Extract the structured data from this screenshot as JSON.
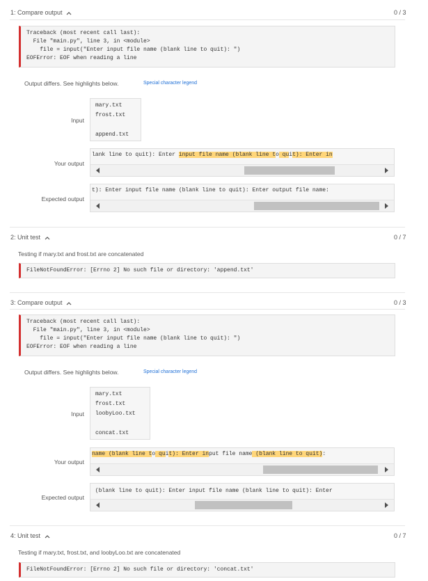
{
  "sections": [
    {
      "header": "1: Compare output",
      "score": "0 / 3",
      "error": [
        "Traceback (most recent call last):",
        "  File \"main.py\", line 3, in <module>",
        "    file = input(\"Enter input file name (blank line to quit): \")",
        "EOFError: EOF when reading a line"
      ],
      "note": "Output differs. See highlights below.",
      "legend": "Special character legend",
      "input_label": "Input",
      "input_lines": [
        "mary.txt",
        "frost.txt",
        "",
        "append.txt"
      ],
      "your_label": "Your output",
      "your_segments": [
        {
          "t": "lank line to quit): Enter ",
          "h": false
        },
        {
          "t": "input file name (blank line t",
          "h": true
        },
        {
          "t": "o",
          "h": false
        },
        {
          "t": " qu",
          "h": true
        },
        {
          "t": "i",
          "h": false
        },
        {
          "t": "t): Enter in",
          "h": true
        }
      ],
      "expected_label": "Expected output",
      "expected_text": "t): Enter input file name (blank line to quit): Enter output file name:"
    },
    {
      "header": "2: Unit test",
      "score": "0 / 7",
      "text": "Testing if mary.txt and frost.txt are concatenated",
      "error": "FileNotFoundError: [Errno 2] No such file or directory: 'append.txt'"
    },
    {
      "header": "3: Compare output",
      "score": "0 / 3",
      "error": [
        "Traceback (most recent call last):",
        "  File \"main.py\", line 3, in <module>",
        "    file = input(\"Enter input file name (blank line to quit): \")",
        "EOFError: EOF when reading a line"
      ],
      "note": "Output differs. See highlights below.",
      "legend": "Special character legend",
      "input_label": "Input",
      "input_lines": [
        "mary.txt",
        "frost.txt",
        "loobyLoo.txt",
        "",
        "concat.txt"
      ],
      "your_label": "Your output",
      "your_segments": [
        {
          "t": "name (blank line t",
          "h": true
        },
        {
          "t": "o",
          "h": false
        },
        {
          "t": " qu",
          "h": true
        },
        {
          "t": "i",
          "h": false
        },
        {
          "t": "t): Enter in",
          "h": true
        },
        {
          "t": "put file name",
          "h": false
        },
        {
          "t": " (blank line to quit)",
          "h": true
        },
        {
          "t": ":",
          "h": false
        }
      ],
      "expected_label": "Expected output",
      "expected_text": " (blank line to quit): Enter input file name (blank line to quit): Enter"
    },
    {
      "header": "4: Unit test",
      "score": "0 / 7",
      "text": "Testing if mary.txt, frost.txt, and loobyLoo.txt are concatenated",
      "error": "FileNotFoundError: [Errno 2] No such file or directory: 'concat.txt'"
    }
  ]
}
